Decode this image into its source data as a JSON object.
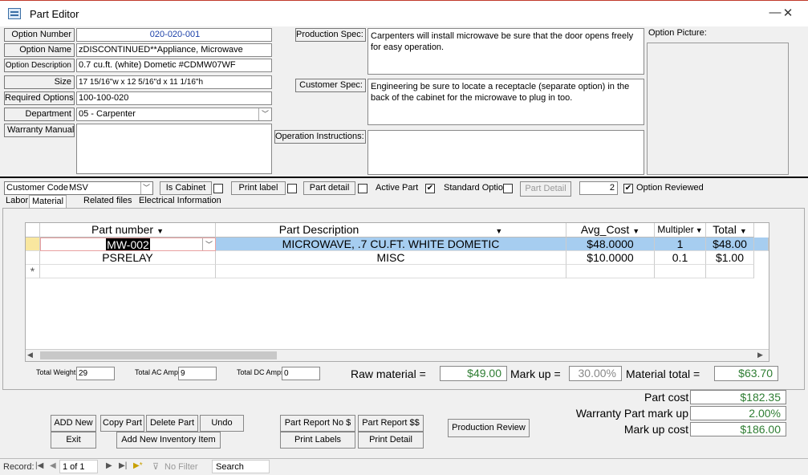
{
  "window": {
    "title": "Part Editor",
    "minimize": "—",
    "close": "✕"
  },
  "form": {
    "option_number": {
      "label": "Option Number",
      "value": "020-020-001"
    },
    "option_name": {
      "label": "Option Name",
      "value": "zDISCONTINUED**Appliance, Microwave"
    },
    "option_description": {
      "label": "Option Description",
      "value": "0.7 cu.ft. (white) Dometic #CDMW07WF"
    },
    "size": {
      "label": "Size",
      "value": "17 15/16\"w x 12 5/16\"d x 11 1/16\"h"
    },
    "required_options": {
      "label": "Required Options",
      "value": "100-100-020"
    },
    "department": {
      "label": "Department",
      "value": "05 - Carpenter"
    },
    "warranty_manual": {
      "label": "Warranty Manual:",
      "value": ""
    },
    "production_spec": {
      "label": "Production Spec:",
      "value": "Carpenters will install microwave be sure that the door opens freely for easy operation."
    },
    "customer_spec": {
      "label": "Customer Spec:",
      "value": "Engineering be sure to locate a receptacle (separate option) in the back of the cabinet for the microwave to plug in too."
    },
    "operation_instructions": {
      "label": "Operation Instructions:",
      "value": ""
    },
    "option_picture": {
      "label": "Option Picture:"
    }
  },
  "options_bar": {
    "customer_code": {
      "label": "Customer Code",
      "value": "MSV"
    },
    "is_cabinet": {
      "label": "Is Cabinet",
      "checked": false
    },
    "print_label": {
      "label": "Print label",
      "checked": false
    },
    "part_detail": {
      "label": "Part detail",
      "checked": false
    },
    "active_part": {
      "label": "Active Part",
      "checked": true
    },
    "standard_option": {
      "label": "Standard Optio",
      "checked": false
    },
    "part_detail_button": "Part Detail",
    "count_value": "2",
    "option_reviewed": {
      "label": "Option Reviewed",
      "checked": true
    }
  },
  "tabs": [
    "Labor",
    "Material",
    "Related files",
    "Electrical Information"
  ],
  "active_tab": "Material",
  "material_grid": {
    "columns": [
      "Part number",
      "Part Description",
      "Avg_Cost",
      "Multipler",
      "Total"
    ],
    "rows": [
      {
        "part_number": "MW-002",
        "description": "MICROWAVE, .7 CU.FT. WHITE DOMETIC",
        "avg_cost": "$48.0000",
        "multiplier": "1",
        "total": "$48.00"
      },
      {
        "part_number": "PSRELAY",
        "description": "MISC",
        "avg_cost": "$10.0000",
        "multiplier": "0.1",
        "total": "$1.00"
      }
    ],
    "new_row_marker": "*"
  },
  "totals": {
    "total_weight": {
      "label": "Total Weight",
      "value": "29"
    },
    "total_ac_amps": {
      "label": "Total AC Amps",
      "value": "9"
    },
    "total_dc_amps": {
      "label": "Total DC Amps",
      "value": "0"
    },
    "raw_material": {
      "label": "Raw material =",
      "value": "$49.00"
    },
    "mark_up": {
      "label": "Mark up =",
      "value": "30.00%"
    },
    "material_total": {
      "label": "Material total =",
      "value": "$63.70"
    }
  },
  "costs": {
    "part_cost": {
      "label": "Part cost",
      "value": "$182.35"
    },
    "warranty_mark_up": {
      "label": "Warranty Part mark up",
      "value": "2.00%"
    },
    "mark_up_cost": {
      "label": "Mark up cost",
      "value": "$186.00"
    }
  },
  "buttons": {
    "add_new": "ADD New",
    "copy_part": "Copy Part",
    "delete_part": "Delete Part",
    "undo": "Undo",
    "exit": "Exit",
    "add_inventory": "Add New Inventory Item",
    "report_no": "Part Report No $",
    "report_dollars": "Part Report $$",
    "print_labels": "Print Labels",
    "print_detail": "Print Detail",
    "production_review": "Production Review"
  },
  "statusbar": {
    "record_label": "Record:",
    "record_value": "1 of 1",
    "no_filter": "No Filter",
    "search": "Search"
  }
}
